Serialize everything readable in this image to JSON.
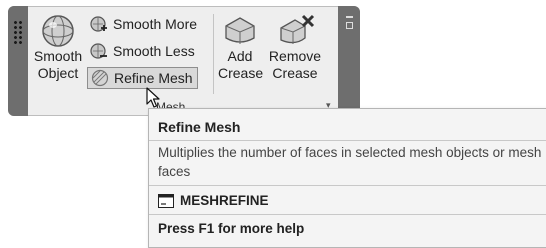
{
  "ribbon": {
    "panel_title": "Mesh",
    "smooth_object": {
      "line1": "Smooth",
      "line2": "Object",
      "icon": "smooth-object-icon"
    },
    "smooth_more": {
      "label": "Smooth More",
      "icon": "smooth-more-icon"
    },
    "smooth_less": {
      "label": "Smooth Less",
      "icon": "smooth-less-icon"
    },
    "refine_mesh": {
      "label": "Refine Mesh",
      "icon": "refine-mesh-icon"
    },
    "add_crease": {
      "line1": "Add",
      "line2": "Crease",
      "icon": "add-crease-icon"
    },
    "remove_crease": {
      "line1": "Remove",
      "line2": "Crease",
      "icon": "remove-crease-icon"
    }
  },
  "tooltip": {
    "title": "Refine Mesh",
    "description": "Multiplies the number of faces in selected mesh objects or mesh faces",
    "command": "MESHREFINE",
    "help": "Press F1 for more help"
  }
}
